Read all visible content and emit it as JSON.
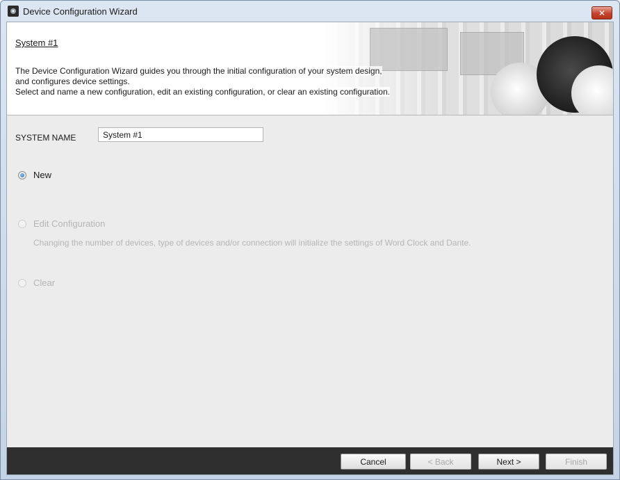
{
  "window": {
    "title": "Device Configuration Wizard",
    "close_label": "✕"
  },
  "header": {
    "title": "System #1",
    "description": [
      "The Device Configuration Wizard guides you through the initial configuration of your system design,",
      "and configures device settings.",
      "Select and name a new configuration, edit an existing configuration, or clear an existing configuration."
    ]
  },
  "system_name": {
    "label": "SYSTEM NAME",
    "value": "System #1"
  },
  "options": {
    "new": {
      "label": "New",
      "checked": true,
      "enabled": true
    },
    "edit": {
      "label": "Edit Configuration",
      "checked": false,
      "enabled": false
    },
    "edit_note": "Changing the number of devices, type of devices and/or connection will initialize the settings of Word Clock and Dante.",
    "clear": {
      "label": "Clear",
      "checked": false,
      "enabled": false
    }
  },
  "buttons": {
    "cancel": "Cancel",
    "back": "< Back",
    "next": "Next >",
    "finish": "Finish"
  },
  "colors": {
    "footer": "#2f2f2f",
    "radio_selected": "#2269b5",
    "close_button": "#c6432e"
  }
}
